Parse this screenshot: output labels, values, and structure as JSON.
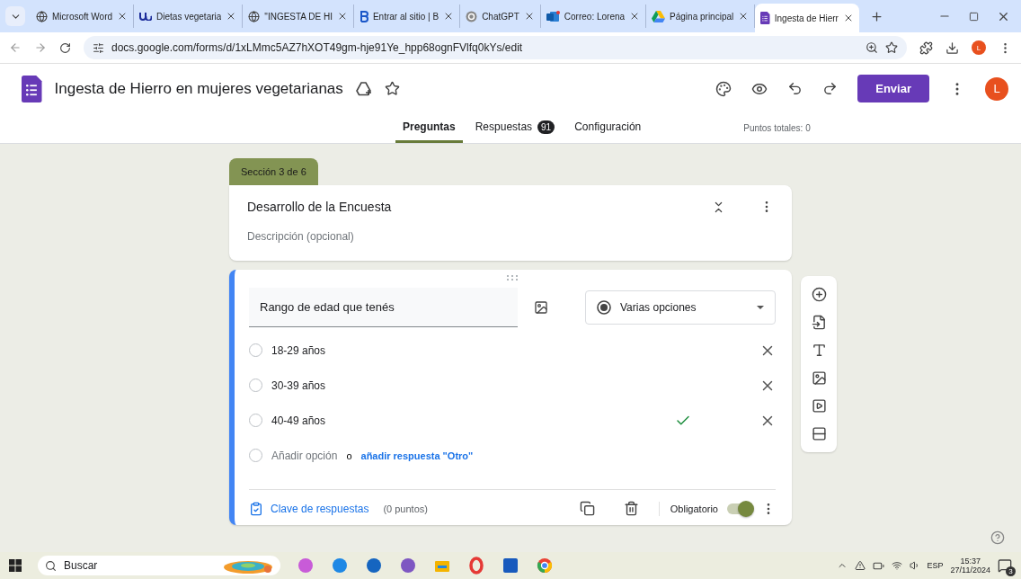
{
  "browser": {
    "tabs": [
      {
        "title": "Microsoft Word",
        "kind": "globe",
        "selected": false
      },
      {
        "title": "Dietas vegetaria",
        "kind": "uoc",
        "selected": false
      },
      {
        "title": "\"INGESTA DE HI",
        "kind": "globe",
        "selected": false
      },
      {
        "title": "Entrar al sitio | B",
        "kind": "letter",
        "selected": false
      },
      {
        "title": "ChatGPT",
        "kind": "chat",
        "selected": false
      },
      {
        "title": "Correo: Lorena",
        "kind": "mail",
        "selected": false
      },
      {
        "title": "Página principal",
        "kind": "drive",
        "selected": false
      },
      {
        "title": "Ingesta de Hierr",
        "kind": "forms",
        "selected": true
      }
    ],
    "url": "docs.google.com/forms/d/1xLMmc5AZ7hXOT49gm-hje91Ye_hpp68ognFVlfq0kYs/edit",
    "avatar": "L"
  },
  "form": {
    "title": "Ingesta de Hierro en mujeres vegetarianas",
    "send_button": "Enviar",
    "avatar": "L",
    "nav": [
      {
        "label": "Preguntas",
        "selected": true
      },
      {
        "label": "Respuestas",
        "badge": "91",
        "selected": false
      },
      {
        "label": "Configuración",
        "selected": false
      }
    ],
    "total_points": "Puntos totales: 0"
  },
  "section": {
    "badge": "Sección 3 de 6",
    "title": "Desarrollo de la Encuesta",
    "description_placeholder": "Descripción (opcional)"
  },
  "question": {
    "title": "Rango de edad que tenés",
    "type": "Varias opciones",
    "options": [
      {
        "label": "18-29 años",
        "correct": false,
        "selected": false
      },
      {
        "label": "30-39 años",
        "correct": false,
        "selected": false
      },
      {
        "label": "40-49 años",
        "correct": true,
        "selected": false
      }
    ],
    "add_option": "Añadir opción",
    "or": "o",
    "add_other": "añadir respuesta \"Otro\"",
    "answer_key": "Clave de respuestas",
    "points": "(0 puntos)",
    "required_label": "Obligatorio",
    "required": true
  },
  "taskbar": {
    "search": "Buscar",
    "language": "ESP",
    "time": "15:37",
    "date": "27/11/2024",
    "notifications": "3"
  }
}
